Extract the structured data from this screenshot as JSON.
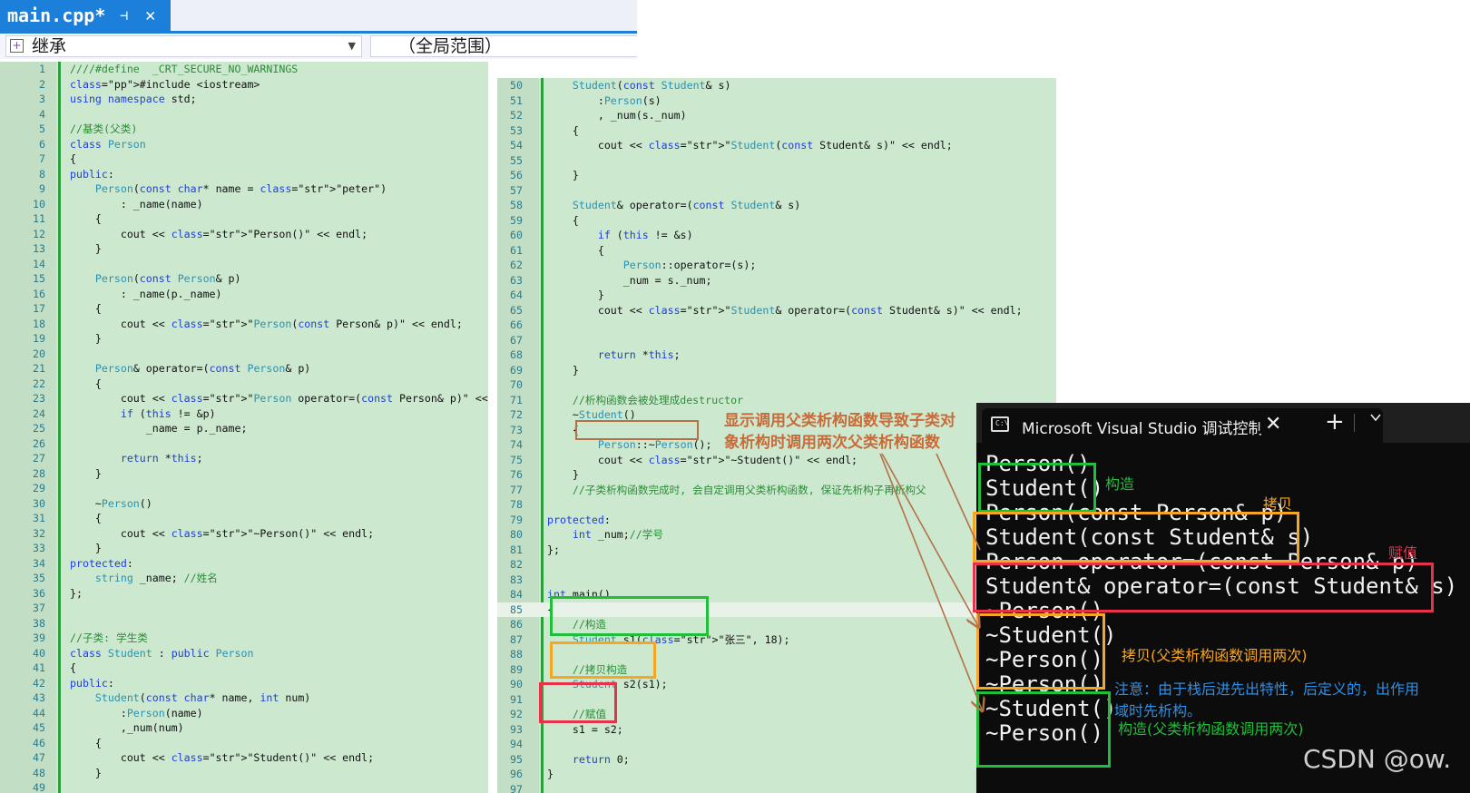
{
  "tab": {
    "label": "main.cpp*",
    "pin_glyph": "⊣",
    "close_glyph": "✕"
  },
  "navbar": {
    "scope": "继承",
    "member": "（全局范围）"
  },
  "left_code": [
    {
      "n": "1",
      "t": "////#define  _CRT_SECURE_NO_WARNINGS"
    },
    {
      "n": "2",
      "t": "#include <iostream>"
    },
    {
      "n": "3",
      "t": "using namespace std;"
    },
    {
      "n": "4",
      "t": ""
    },
    {
      "n": "5",
      "t": "//基类(父类)"
    },
    {
      "n": "6",
      "t": "class Person"
    },
    {
      "n": "7",
      "t": "{"
    },
    {
      "n": "8",
      "t": "public:"
    },
    {
      "n": "9",
      "t": "    Person(const char* name = \"peter\")"
    },
    {
      "n": "10",
      "t": "        : _name(name)"
    },
    {
      "n": "11",
      "t": "    {"
    },
    {
      "n": "12",
      "t": "        cout << \"Person()\" << endl;"
    },
    {
      "n": "13",
      "t": "    }"
    },
    {
      "n": "14",
      "t": ""
    },
    {
      "n": "15",
      "t": "    Person(const Person& p)"
    },
    {
      "n": "16",
      "t": "        : _name(p._name)"
    },
    {
      "n": "17",
      "t": "    {"
    },
    {
      "n": "18",
      "t": "        cout << \"Person(const Person& p)\" << endl;"
    },
    {
      "n": "19",
      "t": "    }"
    },
    {
      "n": "20",
      "t": ""
    },
    {
      "n": "21",
      "t": "    Person& operator=(const Person& p)"
    },
    {
      "n": "22",
      "t": "    {"
    },
    {
      "n": "23",
      "t": "        cout << \"Person operator=(const Person& p)\" << endl;"
    },
    {
      "n": "24",
      "t": "        if (this != &p)"
    },
    {
      "n": "25",
      "t": "            _name = p._name;"
    },
    {
      "n": "26",
      "t": ""
    },
    {
      "n": "27",
      "t": "        return *this;"
    },
    {
      "n": "28",
      "t": "    }"
    },
    {
      "n": "29",
      "t": ""
    },
    {
      "n": "30",
      "t": "    ~Person()"
    },
    {
      "n": "31",
      "t": "    {"
    },
    {
      "n": "32",
      "t": "        cout << \"~Person()\" << endl;"
    },
    {
      "n": "33",
      "t": "    }"
    },
    {
      "n": "34",
      "t": "protected:"
    },
    {
      "n": "35",
      "t": "    string _name; //姓名"
    },
    {
      "n": "36",
      "t": "};"
    },
    {
      "n": "37",
      "t": ""
    },
    {
      "n": "38",
      "t": ""
    },
    {
      "n": "39",
      "t": "//子类: 学生类"
    },
    {
      "n": "40",
      "t": "class Student : public Person"
    },
    {
      "n": "41",
      "t": "{"
    },
    {
      "n": "42",
      "t": "public:"
    },
    {
      "n": "43",
      "t": "    Student(const char* name, int num)"
    },
    {
      "n": "44",
      "t": "        :Person(name)"
    },
    {
      "n": "45",
      "t": "        ,_num(num)"
    },
    {
      "n": "46",
      "t": "    {"
    },
    {
      "n": "47",
      "t": "        cout << \"Student()\" << endl;"
    },
    {
      "n": "48",
      "t": "    }"
    },
    {
      "n": "49",
      "t": ""
    }
  ],
  "right_code": [
    {
      "n": "50",
      "t": "    Student(const Student& s)"
    },
    {
      "n": "51",
      "t": "        :Person(s)"
    },
    {
      "n": "52",
      "t": "        , _num(s._num)"
    },
    {
      "n": "53",
      "t": "    {"
    },
    {
      "n": "54",
      "t": "        cout << \"Student(const Student& s)\" << endl;"
    },
    {
      "n": "55",
      "t": ""
    },
    {
      "n": "56",
      "t": "    }"
    },
    {
      "n": "57",
      "t": ""
    },
    {
      "n": "58",
      "t": "    Student& operator=(const Student& s)"
    },
    {
      "n": "59",
      "t": "    {"
    },
    {
      "n": "60",
      "t": "        if (this != &s)"
    },
    {
      "n": "61",
      "t": "        {"
    },
    {
      "n": "62",
      "t": "            Person::operator=(s);"
    },
    {
      "n": "63",
      "t": "            _num = s._num;"
    },
    {
      "n": "64",
      "t": "        }"
    },
    {
      "n": "65",
      "t": "        cout << \"Student& operator=(const Student& s)\" << endl;"
    },
    {
      "n": "66",
      "t": ""
    },
    {
      "n": "67",
      "t": ""
    },
    {
      "n": "68",
      "t": "        return *this;"
    },
    {
      "n": "69",
      "t": "    }"
    },
    {
      "n": "70",
      "t": ""
    },
    {
      "n": "71",
      "t": "    //析构函数会被处理成destructor"
    },
    {
      "n": "72",
      "t": "    ~Student()"
    },
    {
      "n": "73",
      "t": "    {"
    },
    {
      "n": "74",
      "t": "        Person::~Person();"
    },
    {
      "n": "75",
      "t": "        cout << \"~Student()\" << endl;"
    },
    {
      "n": "76",
      "t": "    }"
    },
    {
      "n": "77",
      "t": "    //子类析构函数完成时, 会自定调用父类析构函数, 保证先析构子再析构父"
    },
    {
      "n": "78",
      "t": ""
    },
    {
      "n": "79",
      "t": "protected:"
    },
    {
      "n": "80",
      "t": "    int _num;//学号"
    },
    {
      "n": "81",
      "t": "};"
    },
    {
      "n": "82",
      "t": ""
    },
    {
      "n": "83",
      "t": ""
    },
    {
      "n": "84",
      "t": "int main()"
    },
    {
      "n": "85",
      "t": "{"
    },
    {
      "n": "86",
      "t": "    //构造"
    },
    {
      "n": "87",
      "t": "    Student s1(\"张三\", 18);"
    },
    {
      "n": "88",
      "t": ""
    },
    {
      "n": "89",
      "t": "    //拷贝构造"
    },
    {
      "n": "90",
      "t": "    Student s2(s1);"
    },
    {
      "n": "91",
      "t": ""
    },
    {
      "n": "92",
      "t": "    //赋值"
    },
    {
      "n": "93",
      "t": "    s1 = s2;"
    },
    {
      "n": "94",
      "t": ""
    },
    {
      "n": "95",
      "t": "    return 0;"
    },
    {
      "n": "96",
      "t": "}"
    },
    {
      "n": "97",
      "t": ""
    }
  ],
  "note": {
    "line1": "显示调用父类析构函数导致子类对",
    "line2": "象析构时调用两次父类析构函数"
  },
  "console": {
    "title": "Microsoft Visual Studio 调试控制台",
    "close_glyph": "✕",
    "plus_glyph": "+",
    "lines": [
      "Person()",
      "Student()",
      "Person(const Person& p)",
      "Student(const Student& s)",
      "Person operator=(const Person& p)",
      "Student& operator=(const Student& s)",
      "~Person()",
      "~Student()",
      "~Person()",
      "~Person()",
      "~Student()",
      "~Person()"
    ],
    "labels": {
      "construct": "构造",
      "copy": "拷贝",
      "assign": "赋值",
      "copy_destruct": "拷贝(父类析构函数调用两次)",
      "note": "注意：由于栈后进先出特性，后定义的，出作用",
      "note2": "域时先析构。",
      "construct_destruct": "构造(父类析构函数调用两次)"
    }
  },
  "watermark": "CSDN @ow.",
  "colors": {
    "green": "#1fbf3a",
    "orange": "#f5a623",
    "red": "#e8324a",
    "note_blue": "#2e8fe6",
    "arrow": "#b5704a"
  }
}
